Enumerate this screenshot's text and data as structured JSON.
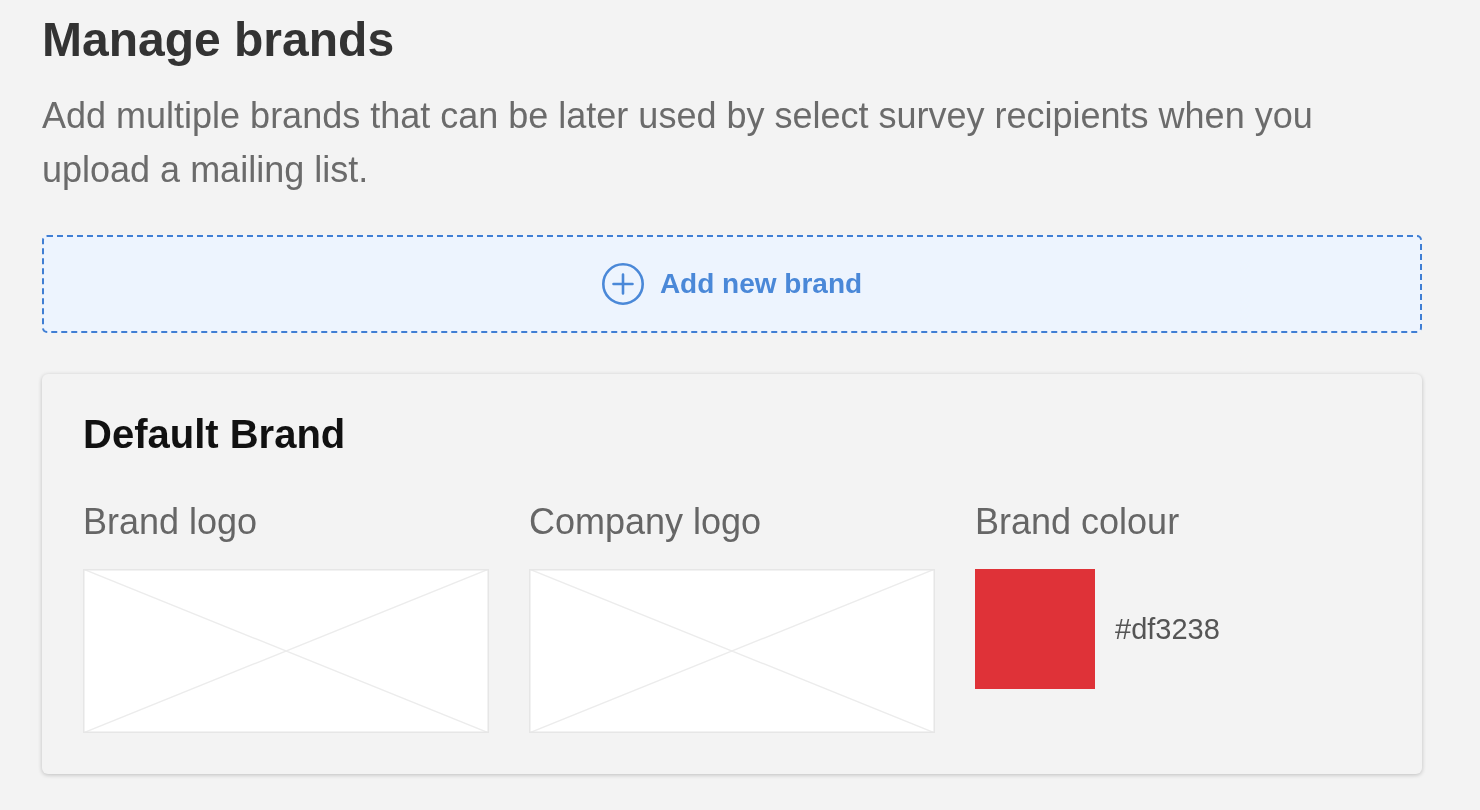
{
  "page": {
    "title": "Manage brands",
    "description": "Add multiple brands that can be later used by select survey recipients when you upload a mailing list."
  },
  "add_button": {
    "label": "Add new brand"
  },
  "brands": [
    {
      "name": "Default Brand",
      "fields": [
        {
          "kind": "logo",
          "label": "Brand logo"
        },
        {
          "kind": "logo",
          "label": "Company logo"
        },
        {
          "kind": "colour",
          "label": "Brand colour",
          "color": "#df3238",
          "value": "#df3238"
        }
      ]
    }
  ]
}
